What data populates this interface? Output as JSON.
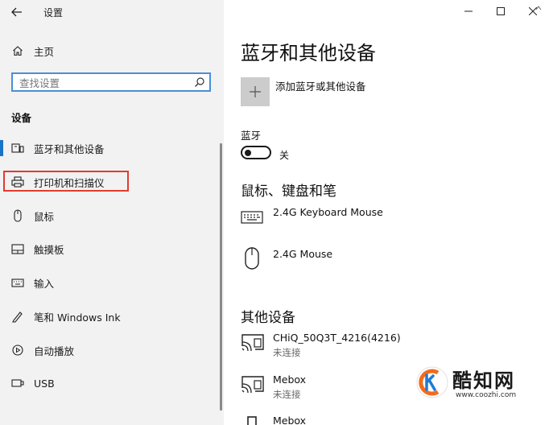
{
  "window": {
    "title": "设置"
  },
  "sidebar": {
    "home_label": "主页",
    "search_placeholder": "查找设置",
    "section_title": "设备",
    "items": [
      {
        "label": "蓝牙和其他设备",
        "icon": "bluetooth-devices-icon",
        "active": true
      },
      {
        "label": "打印机和扫描仪",
        "icon": "printer-icon",
        "highlighted": true
      },
      {
        "label": "鼠标",
        "icon": "mouse-icon"
      },
      {
        "label": "触摸板",
        "icon": "touchpad-icon"
      },
      {
        "label": "输入",
        "icon": "keyboard-icon"
      },
      {
        "label": "笔和 Windows Ink",
        "icon": "pen-icon"
      },
      {
        "label": "自动播放",
        "icon": "autoplay-icon"
      },
      {
        "label": "USB",
        "icon": "usb-icon"
      }
    ]
  },
  "main": {
    "title": "蓝牙和其他设备",
    "add_device_label": "添加蓝牙或其他设备",
    "bluetooth": {
      "label": "蓝牙",
      "state": "关",
      "on": false
    },
    "input_section": {
      "title": "鼠标、键盘和笔",
      "devices": [
        {
          "name": "2.4G Keyboard Mouse",
          "icon": "keyboard-icon"
        },
        {
          "name": "2.4G Mouse",
          "icon": "mouse-icon"
        }
      ]
    },
    "other_section": {
      "title": "其他设备",
      "devices": [
        {
          "name": "CHiQ_50Q3T_4216(4216)",
          "status": "未连接",
          "icon": "cast-display-icon"
        },
        {
          "name": "Mebox",
          "status": "未连接",
          "icon": "cast-display-icon"
        },
        {
          "name": "Mebox",
          "icon": "media-device-icon"
        }
      ]
    }
  },
  "watermark": {
    "text": "酷知网",
    "url": "www.coozhi.com"
  },
  "colors": {
    "accent": "#1a73c8",
    "highlight": "#e23b2e",
    "sidebar_bg": "#f2f2f2",
    "search_border": "#4a8fd9"
  }
}
